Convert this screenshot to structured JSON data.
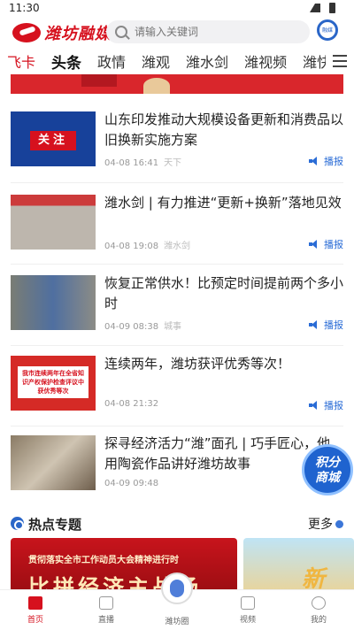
{
  "status": {
    "time": "11:30"
  },
  "header": {
    "logo_text": "潍坊融媒",
    "search_placeholder": "请输入关键词",
    "badge_text": "融媒"
  },
  "tabs": [
    "飞卡",
    "头条",
    "政情",
    "潍观",
    "潍水剑",
    "潍视频",
    "潍快报"
  ],
  "active_tab": "头条",
  "feed": [
    {
      "title": "山东印发推动大规模设备更新和消费品以旧换新实施方案",
      "time": "04-08 16:41",
      "source": "天下",
      "action": "播报",
      "thumb_text": "关注"
    },
    {
      "title": "潍水剑 | 有力推进“更新+换新”落地见效",
      "time": "04-08 19:08",
      "source": "潍水剑",
      "action": "播报"
    },
    {
      "title": "恢复正常供水！比预定时间提前两个多小时",
      "time": "04-09 08:38",
      "source": "城事",
      "action": "播报"
    },
    {
      "title": "连续两年，潍坊获评优秀等次！",
      "time": "04-08 21:32",
      "source": "",
      "action": "播报",
      "thumb_text": "我市连续两年在全省知识产权保护检查评议中获优秀等次"
    },
    {
      "title": "探寻经济活力“潍”面孔 | 巧手匠心，他用陶瓷作品讲好潍坊故事",
      "time": "04-09 09:48",
      "source": "",
      "action": ""
    }
  ],
  "float_button": {
    "line1": "积分",
    "line2": "商城"
  },
  "section": {
    "title": "热点专题",
    "more": "更多"
  },
  "cards": [
    {
      "small": "贯彻落实全市工作动员大会精神进行时",
      "big": "比拼经济主战场"
    },
    {
      "big": "新"
    }
  ],
  "bottom_nav": [
    {
      "label": "首页"
    },
    {
      "label": "直播"
    },
    {
      "label": "潍坊圈"
    },
    {
      "label": "视频"
    },
    {
      "label": "我的"
    }
  ],
  "colors": {
    "brand": "#d6111e",
    "accent": "#2a6cd6"
  }
}
